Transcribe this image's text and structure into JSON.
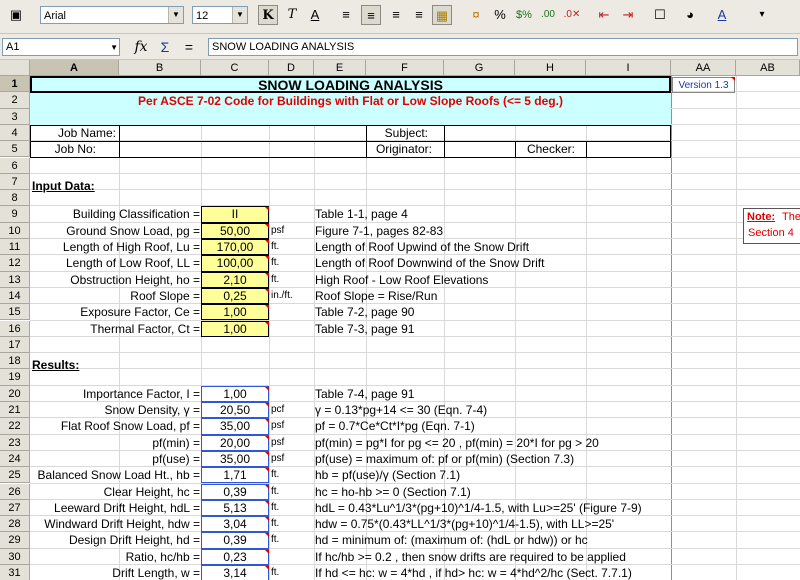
{
  "toolbar": {
    "font_name": "Arial",
    "font_size": "12"
  },
  "formula_bar": {
    "cell_ref": "A1",
    "content": "SNOW LOADING ANALYSIS"
  },
  "columns": [
    "A",
    "B",
    "C",
    "D",
    "E",
    "F",
    "G",
    "H",
    "I",
    "AA",
    "AB"
  ],
  "rows": [
    "1",
    "2",
    "3",
    "4",
    "5",
    "6",
    "7",
    "8",
    "9",
    "10",
    "11",
    "12",
    "13",
    "14",
    "15",
    "16",
    "17",
    "18",
    "19",
    "20",
    "21",
    "22",
    "23",
    "24",
    "25",
    "26",
    "27",
    "28",
    "29",
    "30",
    "31"
  ],
  "title": "SNOW LOADING ANALYSIS",
  "subtitle": "Per ASCE 7-02 Code for Buildings with Flat or Low Slope Roofs (<= 5 deg.)",
  "version": "Version 1.3",
  "header_fields": {
    "job_name": "Job Name:",
    "job_no": "Job No:",
    "subject": "Subject:",
    "originator": "Originator:",
    "checker": "Checker:"
  },
  "input_title": "Input Data:",
  "results_title": "Results:",
  "note": {
    "label": "Note:",
    "text1": " The",
    "text2": "Section 4"
  },
  "inputs": [
    {
      "label": "Building Classification =",
      "value": "II",
      "unit": "",
      "ref": "Table 1-1, page 4"
    },
    {
      "label": "Ground Snow Load, pg =",
      "value": "50,00",
      "unit": "psf",
      "ref": "Figure 7-1, pages 82-83"
    },
    {
      "label": "Length of High Roof, Lu =",
      "value": "170,00",
      "unit": "ft.",
      "ref": "Length of Roof Upwind of the Snow Drift"
    },
    {
      "label": "Length of Low Roof, LL =",
      "value": "100,00",
      "unit": "ft.",
      "ref": "Length of Roof Downwind of the Snow Drift"
    },
    {
      "label": "Obstruction Height, ho =",
      "value": "2,10",
      "unit": "ft.",
      "ref": "High Roof - Low Roof Elevations"
    },
    {
      "label": "Roof Slope =",
      "value": "0,25",
      "unit": "in./ft.",
      "ref": "Roof Slope = Rise/Run"
    },
    {
      "label": "Exposure Factor, Ce =",
      "value": "1,00",
      "unit": "",
      "ref": "Table 7-2, page 90"
    },
    {
      "label": "Thermal Factor, Ct =",
      "value": "1,00",
      "unit": "",
      "ref": "Table 7-3, page 91"
    }
  ],
  "results": [
    {
      "label": "Importance Factor, I =",
      "value": "1,00",
      "unit": "",
      "ref": "Table 7-4, page 91"
    },
    {
      "label": "Snow Density, γ =",
      "value": "20,50",
      "unit": "pcf",
      "ref": "γ = 0.13*pg+14 <= 30  (Eqn. 7-4)"
    },
    {
      "label": "Flat Roof Snow Load, pf =",
      "value": "35,00",
      "unit": "psf",
      "ref": "pf = 0.7*Ce*Ct*I*pg  (Eqn. 7-1)"
    },
    {
      "label": "pf(min) =",
      "value": "20,00",
      "unit": "psf",
      "ref": "pf(min) = pg*I  for pg <= 20 ,  pf(min) = 20*I  for pg > 20"
    },
    {
      "label": "pf(use) =",
      "value": "35,00",
      "unit": "psf",
      "ref": "pf(use) = maximum of:  pf  or  pf(min)  (Section 7.3)"
    },
    {
      "label": "Balanced Snow Load Ht., hb =",
      "value": "1,71",
      "unit": "ft.",
      "ref": "hb = pf(use)/γ  (Section 7.1)"
    },
    {
      "label": "Clear Height, hc =",
      "value": "0,39",
      "unit": "ft.",
      "ref": "hc = ho-hb >= 0  (Section 7.1)"
    },
    {
      "label": "Leeward Drift Height, hdL =",
      "value": "5,13",
      "unit": "ft.",
      "ref": "hdL = 0.43*Lu^1/3*(pg+10)^1/4-1.5,  with Lu>=25'  (Figure 7-9)"
    },
    {
      "label": "Windward Drift Height, hdw =",
      "value": "3,04",
      "unit": "ft.",
      "ref": "hdw = 0.75*(0.43*LL^1/3*(pg+10)^1/4-1.5),  with LL>=25'"
    },
    {
      "label": "Design Drift Height, hd =",
      "value": "0,39",
      "unit": "ft.",
      "ref": "hd = minimum of: (maximum of: (hdL  or  hdw))  or  hc"
    },
    {
      "label": "Ratio, hc/hb =",
      "value": "0,23",
      "unit": "",
      "ref": "If hc/hb >= 0.2 , then snow drifts are required to be applied"
    },
    {
      "label": "Drift Length, w =",
      "value": "3,14",
      "unit": "ft.",
      "ref": "If hd <= hc:  w = 4*hd ,  if hd> hc:  w = 4*hd^2/hc  (Sect. 7.7.1)"
    }
  ]
}
